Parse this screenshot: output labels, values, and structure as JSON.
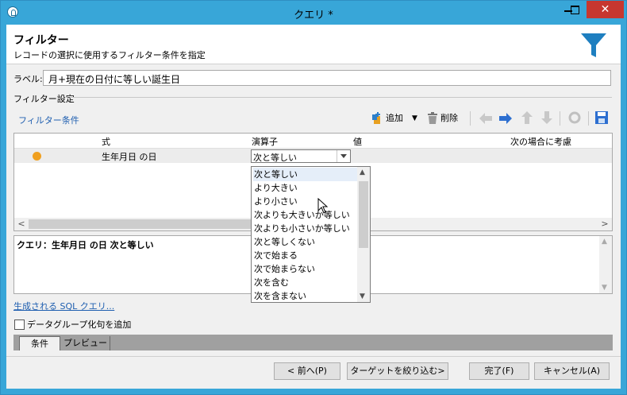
{
  "window": {
    "title": "クエリ *"
  },
  "header": {
    "title": "フィルター",
    "subtitle": "レコードの選択に使用するフィルター条件を指定"
  },
  "label_field": {
    "label": "ラベル:",
    "value": "月+現在の日付に等しい誕生日"
  },
  "filter_settings": {
    "group_label": "フィルター設定"
  },
  "toolbar": {
    "title": "フィルター条件",
    "add_label": "追加",
    "delete_label": "削除",
    "icons": [
      "add-icon",
      "delete-icon",
      "arrow-left-icon",
      "arrow-right-icon",
      "arrow-up-icon",
      "arrow-down-icon",
      "refresh-icon",
      "save-icon"
    ]
  },
  "grid": {
    "columns": [
      "式",
      "演算子",
      "値",
      "次の場合に考慮"
    ],
    "rows": [
      {
        "expression": "生年月日 の日",
        "operator": "次と等しい",
        "value": "",
        "consider_if": ""
      }
    ]
  },
  "operator_dropdown": {
    "items": [
      "次と等しい",
      "より大きい",
      "より小さい",
      "次よりも大きいか等しい",
      "次よりも小さいか等しい",
      "次と等しくない",
      "次で始まる",
      "次で始まらない",
      "次を含む",
      "次を含まない"
    ],
    "highlighted": "次と等しい"
  },
  "query_preview": {
    "text": "クエリ：生年月日 の日 次と等しい"
  },
  "sql_link": {
    "text": "生成される SQL クエリ..."
  },
  "data_grouping": {
    "label": "データグループ化句を追加",
    "checked": false
  },
  "tabs": [
    {
      "label": "条件",
      "active": true
    },
    {
      "label": "プレビュー",
      "active": false
    }
  ],
  "buttons": {
    "prev": "< 前へ(P)",
    "narrow": "ターゲットを絞り込む>",
    "finish": "完了(F)",
    "cancel": "キャンセル(A)"
  },
  "colors": {
    "title_bar": "#38a6d8",
    "close_button": "#c7372f",
    "link": "#1f5fb0",
    "funnel": "#1e7fc0",
    "status_dot": "#f0a020"
  }
}
